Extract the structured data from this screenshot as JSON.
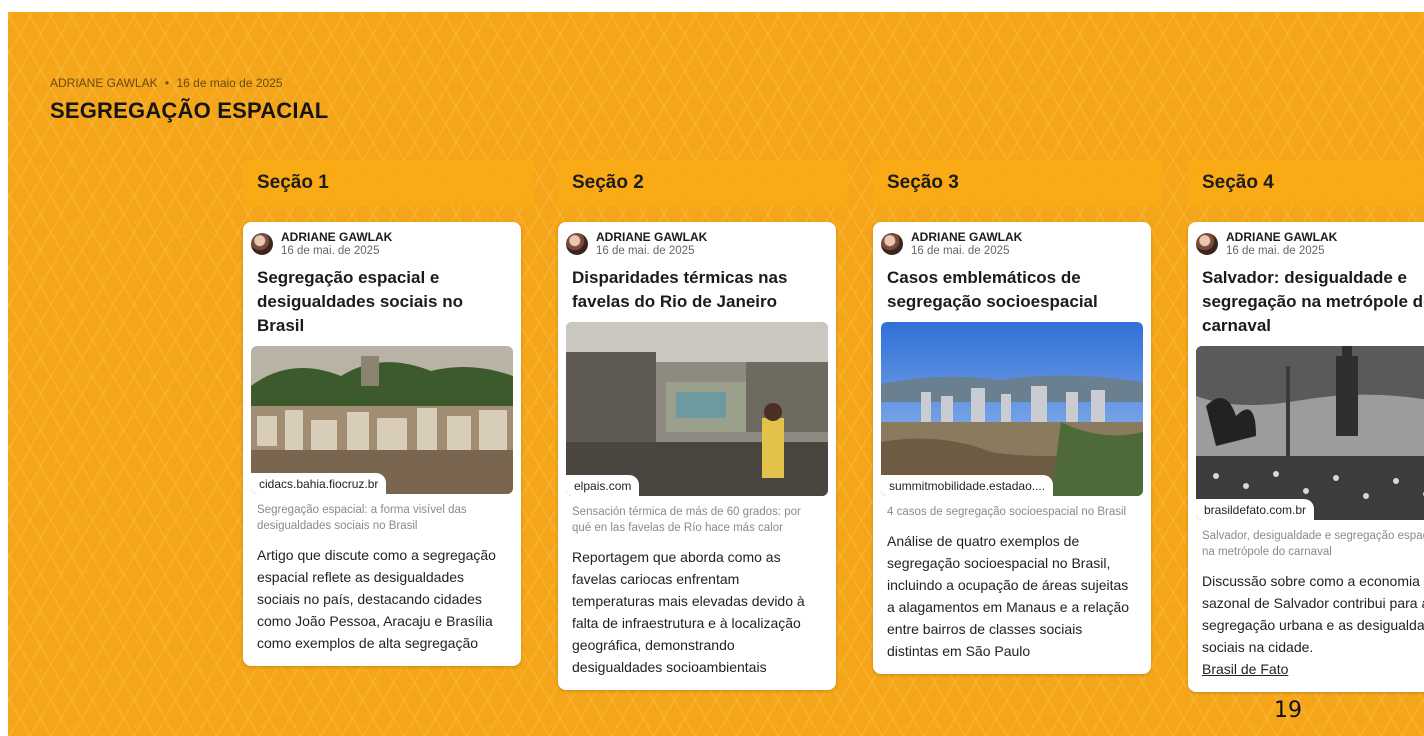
{
  "header": {
    "author": "ADRIANE GAWLAK",
    "separator": "•",
    "date": "16 de maio de 2025",
    "title": "SEGREGAÇÃO ESPACIAL"
  },
  "columns": [
    {
      "heading": "Seção 1",
      "card": {
        "author": "ADRIANE GAWLAK",
        "date": "16 de mai. de 2025",
        "title": "Segregação espacial e desigualdades sociais no Brasil",
        "image_icon": "city-hillside-photo",
        "source": "cidacs.bahia.fiocruz.br",
        "caption": "Segregação espacial: a forma visível das desigualdades sociais no Brasil",
        "description": "Artigo que discute como a segregação espacial reflete as desigualdades sociais no país, destacando cidades como João Pessoa, Aracaju e Brasília como exemplos de alta segregação",
        "link": ""
      }
    },
    {
      "heading": "Seção 2",
      "card": {
        "author": "ADRIANE GAWLAK",
        "date": "16 de mai. de 2025",
        "title": "Disparidades térmicas nas favelas do Rio de Janeiro",
        "image_icon": "favela-rooftop-photo",
        "source": "elpais.com",
        "caption": "Sensación térmica de más de 60 grados: por qué en las favelas de Río hace más calor",
        "description": "Reportagem que aborda como as favelas cariocas enfrentam temperaturas mais elevadas devido à falta de infraestrutura e à localização geográfica, demonstrando desigualdades socioambientais",
        "link": ""
      }
    },
    {
      "heading": "Seção 3",
      "card": {
        "author": "ADRIANE GAWLAK",
        "date": "16 de mai. de 2025",
        "title": "Casos emblemáticos de segregação socioespacial",
        "image_icon": "city-skyline-photo",
        "source": "summitmobilidade.estadao....",
        "caption": "4 casos de segregação socioespacial no Brasil",
        "description": "Análise de quatro exemplos de segregação socioespacial no Brasil, incluindo a ocupação de áreas sujeitas a alagamentos em Manaus e a relação entre bairros de classes sociais distintas em São Paulo",
        "link": ""
      }
    },
    {
      "heading": "Seção 4",
      "card": {
        "author": "ADRIANE GAWLAK",
        "date": "16 de mai. de 2025",
        "title": "Salvador: desigualdade e segregação na metrópole do carnaval",
        "image_icon": "carnival-crowd-photo",
        "source": "brasildefato.com.br",
        "caption": "Salvador, desigualdade e segregação espacial na metrópole do carnaval",
        "description": "Discussão sobre como a economia sazonal de Salvador contribui para a segregação urbana e as desigualdades sociais na cidade.",
        "link": "Brasil de Fato"
      }
    }
  ],
  "page_number": "19",
  "colors": {
    "board": "#f9b323",
    "column_header": "#f9aa14",
    "card": "#ffffff"
  }
}
